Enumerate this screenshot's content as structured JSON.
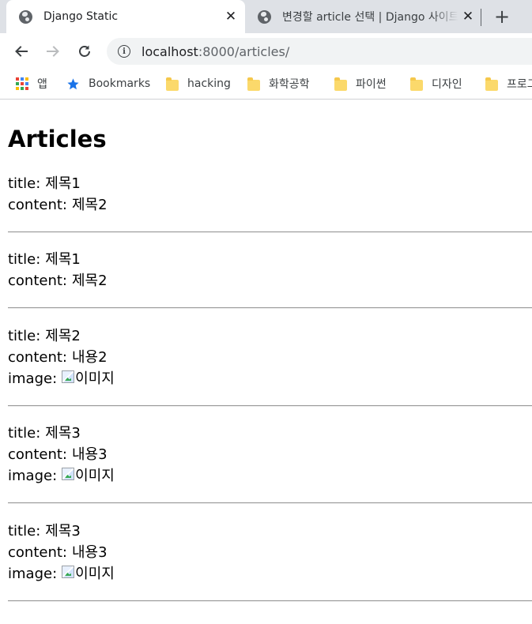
{
  "browser": {
    "tabs": [
      {
        "title": "Django Static",
        "active": true
      },
      {
        "title": "변경할 article 선택 | Django 사이트 관리",
        "active": false
      }
    ],
    "new_tab_icon": "plus-icon",
    "address": {
      "host": "localhost",
      "path": ":8000/articles/"
    },
    "bookmarks": [
      {
        "label": "앱",
        "icon": "apps-grid-icon"
      },
      {
        "label": "Bookmarks",
        "icon": "star-icon"
      },
      {
        "label": "hacking",
        "icon": "folder-icon"
      },
      {
        "label": "화학공학",
        "icon": "folder-icon"
      },
      {
        "label": "파이썬",
        "icon": "folder-icon"
      },
      {
        "label": "디자인",
        "icon": "folder-icon"
      },
      {
        "label": "프로그래밍",
        "icon": "folder-icon"
      }
    ]
  },
  "page": {
    "title": "Articles",
    "labels": {
      "title": "title:",
      "content": "content:",
      "image": "image:"
    },
    "articles": [
      {
        "title": "제목1",
        "content": "제목2",
        "image_alt": ""
      },
      {
        "title": "제목1",
        "content": "제목2",
        "image_alt": ""
      },
      {
        "title": "제목2",
        "content": "내용2",
        "image_alt": "이미지"
      },
      {
        "title": "제목3",
        "content": "내용3",
        "image_alt": "이미지"
      },
      {
        "title": "제목3",
        "content": "내용3",
        "image_alt": "이미지"
      }
    ]
  },
  "colors": {
    "tabstrip": "#dee1e6",
    "omnibox": "#f1f3f4",
    "star": "#1a73e8",
    "folder": "#fbd96b",
    "divider": "#9a9a9a"
  }
}
